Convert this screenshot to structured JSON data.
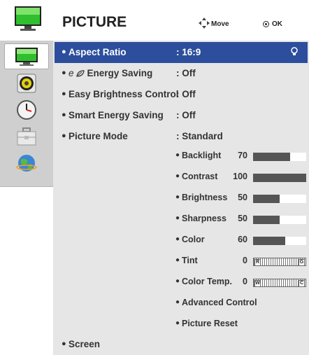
{
  "header": {
    "title": "PICTURE",
    "move_label": "Move",
    "ok_label": "OK"
  },
  "sidebar": {
    "items": [
      {
        "name": "picture",
        "icon": "tv-icon",
        "active": true
      },
      {
        "name": "audio",
        "icon": "speaker-icon",
        "active": false
      },
      {
        "name": "time",
        "icon": "clock-icon",
        "active": false
      },
      {
        "name": "option",
        "icon": "toolbox-icon",
        "active": false
      },
      {
        "name": "network",
        "icon": "globe-icon",
        "active": false
      }
    ]
  },
  "menu": {
    "items": [
      {
        "label": "Aspect Ratio",
        "value": ": 16:9"
      },
      {
        "eco_symbol": "e",
        "label": "Energy Saving",
        "value": ": Off"
      },
      {
        "label": "Easy Brightness Control",
        "value": ": Off"
      },
      {
        "label": "Smart Energy Saving",
        "value": ": Off"
      },
      {
        "label": "Picture Mode",
        "value": ": Standard"
      }
    ],
    "bottom_item": "Screen"
  },
  "picture_settings": {
    "sliders": [
      {
        "label": "Backlight",
        "value": "70",
        "fraction": 0.7
      },
      {
        "label": "Contrast",
        "value": "100",
        "fraction": 1.0
      },
      {
        "label": "Brightness",
        "value": "50",
        "fraction": 0.5
      },
      {
        "label": "Sharpness",
        "value": "50",
        "fraction": 0.5
      },
      {
        "label": "Color",
        "value": "60",
        "fraction": 0.6
      }
    ],
    "balance": [
      {
        "label": "Tint",
        "value": "0",
        "left": "R",
        "right": "G"
      },
      {
        "label": "Color Temp.",
        "value": "0",
        "left": "W",
        "right": "C"
      }
    ],
    "links": [
      {
        "label": "Advanced Control"
      },
      {
        "label": "Picture Reset"
      }
    ]
  },
  "colors": {
    "selected_row": "#2c4e9c",
    "panel_bg": "#e6e6e6",
    "bar_fill": "#555555"
  }
}
